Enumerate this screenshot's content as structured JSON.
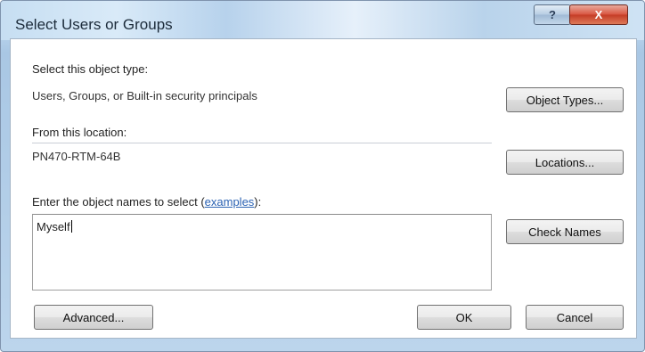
{
  "window": {
    "title": "Select Users or Groups",
    "help_label": "?",
    "close_label": "X"
  },
  "object_type": {
    "label": "Select this object type:",
    "value": "Users, Groups, or Built-in security principals",
    "button_label": "Object Types..."
  },
  "location": {
    "label": "From this location:",
    "value": "PN470-RTM-64B",
    "button_label": "Locations..."
  },
  "names": {
    "label_prefix": "Enter the object names to select (",
    "link_label": "examples",
    "label_suffix": "):",
    "input_value": "Myself",
    "check_button_label": "Check Names"
  },
  "footer": {
    "advanced_label": "Advanced...",
    "ok_label": "OK",
    "cancel_label": "Cancel"
  }
}
